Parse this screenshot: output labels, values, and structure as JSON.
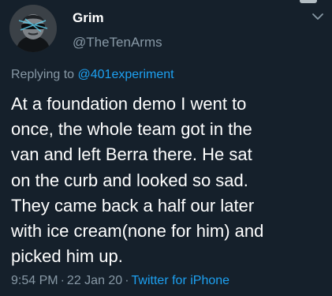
{
  "tweet": {
    "author": {
      "display_name": "Grim",
      "handle": "@TheTenArms",
      "avatar_icon": "user-avatar-sunglasses"
    },
    "menu_icon": "chevron-down-icon",
    "reply": {
      "prefix": "Replying to ",
      "mention": "@401experiment"
    },
    "text_lines": [
      "At a foundation demo I went to",
      "once, the whole team got in the",
      "van and left Berra there. He sat",
      "on the curb and looked so sad.",
      "They came back a half our later",
      "with ice cream(none for him) and",
      "picked him up."
    ],
    "meta": {
      "time": "9:54 PM",
      "separator": "·",
      "date": "22 Jan 20",
      "source": "Twitter for iPhone"
    }
  },
  "colors": {
    "background": "#15202b",
    "text": "#ffffff",
    "secondary": "#8899a6",
    "accent": "#1da1f2"
  }
}
